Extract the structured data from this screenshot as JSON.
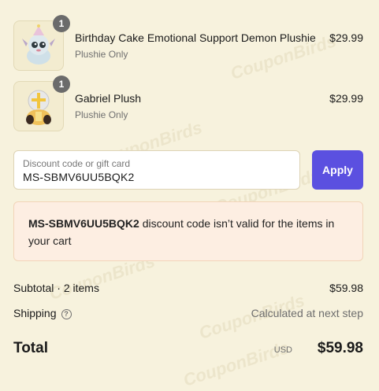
{
  "watermark": "CouponBirds",
  "items": [
    {
      "quantity": "1",
      "name": "Birthday Cake Emotional Support Demon Plushie",
      "variant": "Plushie Only",
      "price": "$29.99",
      "thumb_icon": "demon-plushie-icon"
    },
    {
      "quantity": "1",
      "name": "Gabriel Plush",
      "variant": "Plushie Only",
      "price": "$29.99",
      "thumb_icon": "gabriel-plush-icon"
    }
  ],
  "discount": {
    "label": "Discount code or gift card",
    "value": "MS-SBMV6UU5BQK2",
    "apply_label": "Apply",
    "error_code": "MS-SBMV6UU5BQK2",
    "error_message": " discount code isn’t valid for the items in your cart"
  },
  "summary": {
    "subtotal_label": "Subtotal · 2 items",
    "subtotal_value": "$59.98",
    "shipping_label": "Shipping",
    "shipping_value": "Calculated at next step",
    "total_label": "Total",
    "total_currency": "USD",
    "total_value": "$59.98"
  },
  "colors": {
    "background": "#f7f2dd",
    "accent": "#5b50e0",
    "error_bg": "#fdeee2"
  }
}
